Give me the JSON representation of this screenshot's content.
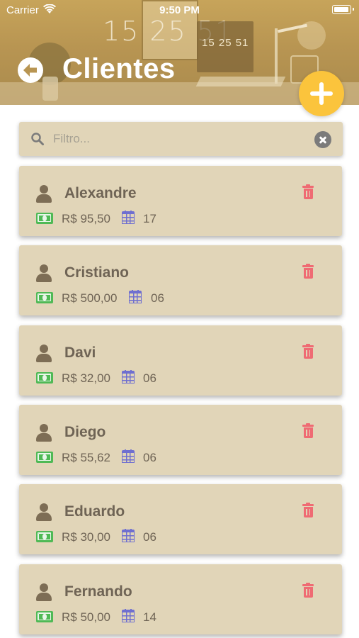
{
  "status_bar": {
    "carrier": "Carrier",
    "time": "9:50 PM"
  },
  "header": {
    "title": "Clientes",
    "background_clock_large": "15 25 51",
    "background_clock_small": "15 25 51"
  },
  "filter": {
    "placeholder": "Filtro...",
    "value": ""
  },
  "colors": {
    "header": "#b89552",
    "card_background": "#e1d5b8",
    "add_button": "#fbc43c",
    "delete_icon": "#ef6b73",
    "money_icon": "#4fb955",
    "calendar_icon": "#6f6fd0",
    "text": "#6f6455"
  },
  "icons": {
    "back": "back-arrow-icon",
    "add": "plus-icon",
    "search": "search-icon",
    "clear": "clear-icon",
    "client": "person-icon",
    "value": "money-icon",
    "day": "calendar-icon",
    "delete": "trash-icon"
  },
  "clients": [
    {
      "name": "Alexandre",
      "value": "R$ 95,50",
      "day": "17"
    },
    {
      "name": "Cristiano",
      "value": "R$ 500,00",
      "day": "06"
    },
    {
      "name": "Davi",
      "value": "R$ 32,00",
      "day": "06"
    },
    {
      "name": "Diego",
      "value": "R$ 55,62",
      "day": "06"
    },
    {
      "name": "Eduardo",
      "value": "R$ 30,00",
      "day": "06"
    },
    {
      "name": "Fernando",
      "value": "R$ 50,00",
      "day": "14"
    }
  ]
}
